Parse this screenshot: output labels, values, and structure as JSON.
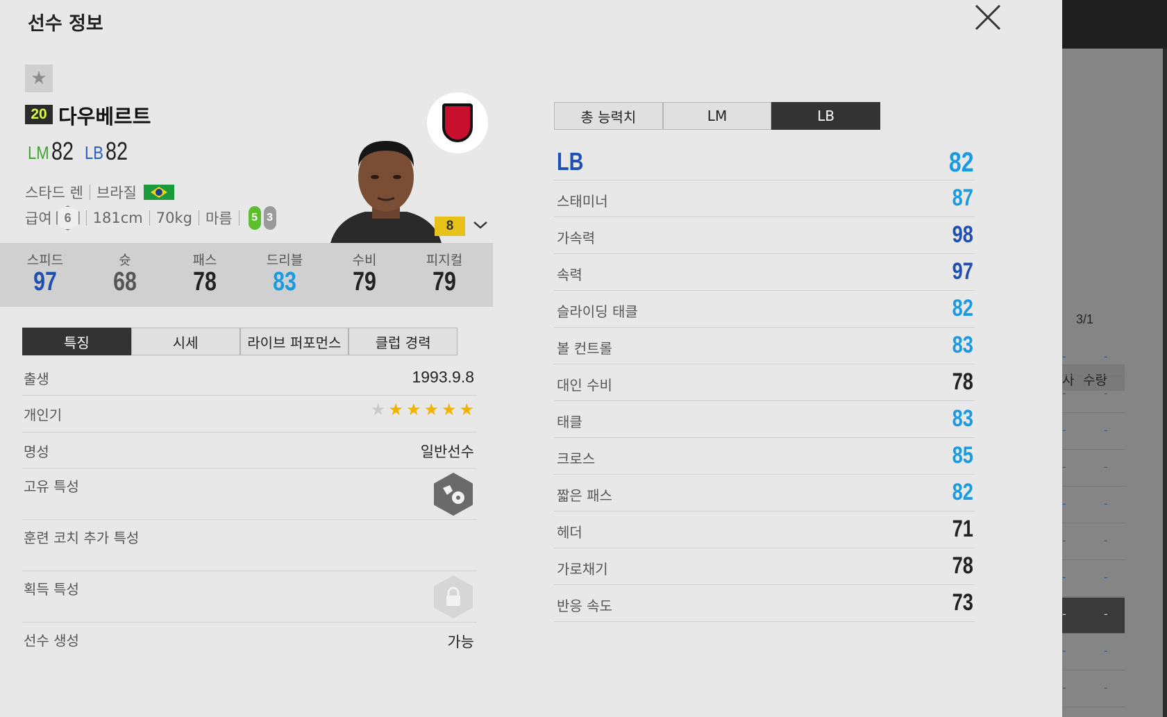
{
  "modal": {
    "title": "선수 정보"
  },
  "player": {
    "season": "20",
    "name": "다우베르트",
    "positions": [
      {
        "label": "LM",
        "value": "82"
      },
      {
        "label": "LB",
        "value": "82"
      }
    ],
    "club": "스타드 렌",
    "nation": "브라질",
    "salary_label": "급여",
    "salary": "6",
    "height": "181cm",
    "weight": "70kg",
    "body_type": "마름",
    "left_foot": "5",
    "right_foot": "3",
    "enhance_level": "8"
  },
  "stats": [
    {
      "label": "스피드",
      "value": "97",
      "color": "#1f4fb0"
    },
    {
      "label": "슛",
      "value": "68",
      "color": "#555555"
    },
    {
      "label": "패스",
      "value": "78",
      "color": "#222222"
    },
    {
      "label": "드리블",
      "value": "83",
      "color": "#1a9ae0"
    },
    {
      "label": "수비",
      "value": "79",
      "color": "#222222"
    },
    {
      "label": "피지컬",
      "value": "79",
      "color": "#222222"
    }
  ],
  "info_tabs": [
    {
      "label": "특징",
      "active": true
    },
    {
      "label": "시세",
      "active": false
    },
    {
      "label": "라이브 퍼포먼스",
      "active": false
    },
    {
      "label": "클럽 경력",
      "active": false
    }
  ],
  "info": {
    "birth": {
      "label": "출생",
      "value": "1993.9.8"
    },
    "popularity": {
      "label": "개인기",
      "stars_filled": 5,
      "stars_total": 6
    },
    "reputation": {
      "label": "명성",
      "value": "일반선수"
    },
    "unique_trait": {
      "label": "고유 특성"
    },
    "coach_trait": {
      "label": "훈련 코치 추가 특성"
    },
    "acquired_trait": {
      "label": "획득 특성"
    },
    "create": {
      "label": "선수 생성",
      "value": "가능"
    }
  },
  "pos_tabs": [
    {
      "label": "총 능력치",
      "active": false
    },
    {
      "label": "LM",
      "active": false
    },
    {
      "label": "LB",
      "active": true
    }
  ],
  "attr_head": {
    "label": "LB",
    "value": "82"
  },
  "attributes": [
    {
      "label": "스태미너",
      "value": "87",
      "color": "#1a9ae0"
    },
    {
      "label": "가속력",
      "value": "98",
      "color": "#1f4fb0"
    },
    {
      "label": "속력",
      "value": "97",
      "color": "#1f4fb0"
    },
    {
      "label": "슬라이딩 태클",
      "value": "82",
      "color": "#1a9ae0"
    },
    {
      "label": "볼 컨트롤",
      "value": "83",
      "color": "#1a9ae0"
    },
    {
      "label": "대인 수비",
      "value": "78",
      "color": "#222222"
    },
    {
      "label": "태클",
      "value": "83",
      "color": "#1a9ae0"
    },
    {
      "label": "크로스",
      "value": "85",
      "color": "#1a9ae0"
    },
    {
      "label": "짧은 패스",
      "value": "82",
      "color": "#1a9ae0"
    },
    {
      "label": "헤더",
      "value": "71",
      "color": "#222222"
    },
    {
      "label": "가로채기",
      "value": "78",
      "color": "#222222"
    },
    {
      "label": "반응 속도",
      "value": "73",
      "color": "#222222"
    }
  ],
  "background_app": {
    "page": "3/1",
    "col_a": "사",
    "col_b": "수량",
    "cell": "-"
  }
}
